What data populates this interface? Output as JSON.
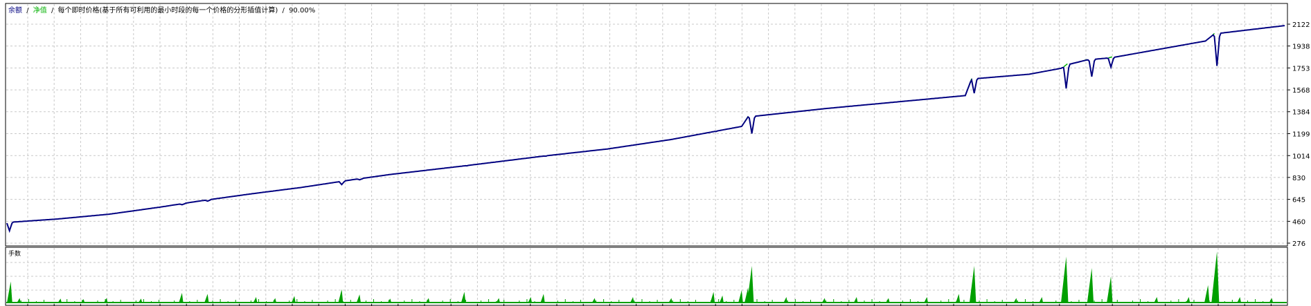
{
  "header": {
    "balance_label": "余额",
    "sep1": "/",
    "equity_label": "净值",
    "sep2": "/",
    "model_text": "每个即时价格(基于所有可利用的最小时段的每一个价格的分形插值计算)",
    "sep3": "/",
    "quality_text": "90.00%"
  },
  "colors": {
    "background": "#ffffff",
    "grid": "#c8c8c8",
    "frame": "#000000",
    "balance": "#000080",
    "equity": "#00b000",
    "volume": "#00a000"
  },
  "chart_data": [
    {
      "type": "line",
      "panel": "main",
      "series": [
        {
          "name": "余额",
          "color": "#000080"
        },
        {
          "name": "净值",
          "color": "#00b000"
        }
      ],
      "x_range": [
        0,
        1000
      ],
      "ylim": [
        276,
        2180
      ],
      "y_ticks": [
        2122,
        1938,
        1753,
        1568,
        1384,
        1199,
        1014,
        830,
        645,
        460,
        276
      ],
      "y_tick_labels": [
        "2122",
        "1938",
        "1753",
        "1568",
        "1384",
        "1199",
        "1014",
        "830",
        "645",
        "460",
        "276"
      ],
      "grid": true,
      "balance_points": [
        [
          0,
          450
        ],
        [
          40,
          480
        ],
        [
          80,
          520
        ],
        [
          120,
          580
        ],
        [
          150,
          630
        ],
        [
          190,
          690
        ],
        [
          230,
          745
        ],
        [
          270,
          810
        ],
        [
          300,
          855
        ],
        [
          360,
          930
        ],
        [
          420,
          1010
        ],
        [
          470,
          1070
        ],
        [
          520,
          1150
        ],
        [
          575,
          1260
        ],
        [
          580,
          1340
        ],
        [
          640,
          1410
        ],
        [
          700,
          1470
        ],
        [
          750,
          1520
        ],
        [
          755,
          1660
        ],
        [
          800,
          1700
        ],
        [
          825,
          1750
        ],
        [
          830,
          1780
        ],
        [
          845,
          1820
        ],
        [
          865,
          1840
        ],
        [
          938,
          1980
        ],
        [
          945,
          2040
        ],
        [
          1000,
          2110
        ]
      ],
      "equity_dips": [
        {
          "x": 2,
          "y": 380
        },
        {
          "x": 137,
          "y": 600
        },
        {
          "x": 157,
          "y": 630
        },
        {
          "x": 262,
          "y": 770
        },
        {
          "x": 276,
          "y": 810
        },
        {
          "x": 358,
          "y": 930
        },
        {
          "x": 420,
          "y": 1010
        },
        {
          "x": 553,
          "y": 1225
        },
        {
          "x": 583,
          "y": 1200
        },
        {
          "x": 757,
          "y": 1540
        },
        {
          "x": 829,
          "y": 1580
        },
        {
          "x": 849,
          "y": 1680
        },
        {
          "x": 864,
          "y": 1760
        },
        {
          "x": 947,
          "y": 1770
        }
      ]
    },
    {
      "type": "bar",
      "panel": "volume",
      "title": "手数",
      "x_range": [
        0,
        1000
      ],
      "ylim": [
        0,
        1
      ],
      "spikes": [
        {
          "x": 3,
          "h": 0.42
        },
        {
          "x": 10,
          "h": 0.1
        },
        {
          "x": 42,
          "h": 0.09
        },
        {
          "x": 60,
          "h": 0.08
        },
        {
          "x": 78,
          "h": 0.1
        },
        {
          "x": 105,
          "h": 0.09
        },
        {
          "x": 137,
          "h": 0.2
        },
        {
          "x": 157,
          "h": 0.18
        },
        {
          "x": 195,
          "h": 0.12
        },
        {
          "x": 210,
          "h": 0.1
        },
        {
          "x": 225,
          "h": 0.14
        },
        {
          "x": 262,
          "h": 0.27
        },
        {
          "x": 276,
          "h": 0.17
        },
        {
          "x": 300,
          "h": 0.09
        },
        {
          "x": 330,
          "h": 0.1
        },
        {
          "x": 358,
          "h": 0.22
        },
        {
          "x": 385,
          "h": 0.1
        },
        {
          "x": 410,
          "h": 0.12
        },
        {
          "x": 420,
          "h": 0.18
        },
        {
          "x": 460,
          "h": 0.1
        },
        {
          "x": 490,
          "h": 0.12
        },
        {
          "x": 520,
          "h": 0.1
        },
        {
          "x": 553,
          "h": 0.22
        },
        {
          "x": 560,
          "h": 0.15
        },
        {
          "x": 575,
          "h": 0.25
        },
        {
          "x": 580,
          "h": 0.3
        },
        {
          "x": 583,
          "h": 0.72
        },
        {
          "x": 610,
          "h": 0.12
        },
        {
          "x": 640,
          "h": 0.1
        },
        {
          "x": 665,
          "h": 0.12
        },
        {
          "x": 690,
          "h": 0.1
        },
        {
          "x": 720,
          "h": 0.12
        },
        {
          "x": 745,
          "h": 0.18
        },
        {
          "x": 757,
          "h": 0.72
        },
        {
          "x": 790,
          "h": 0.1
        },
        {
          "x": 810,
          "h": 0.12
        },
        {
          "x": 829,
          "h": 0.9
        },
        {
          "x": 849,
          "h": 0.68
        },
        {
          "x": 864,
          "h": 0.52
        },
        {
          "x": 900,
          "h": 0.12
        },
        {
          "x": 925,
          "h": 0.12
        },
        {
          "x": 940,
          "h": 0.35
        },
        {
          "x": 947,
          "h": 1.0
        },
        {
          "x": 965,
          "h": 0.12
        },
        {
          "x": 990,
          "h": 0.1
        }
      ],
      "grid": true
    }
  ]
}
